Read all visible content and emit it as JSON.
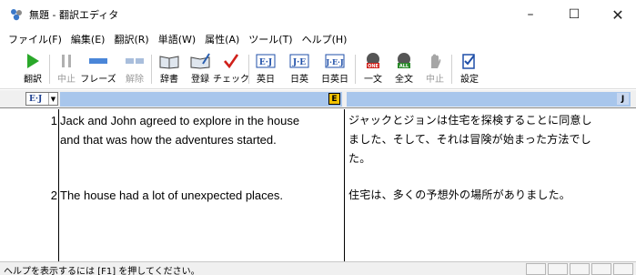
{
  "window": {
    "title": "無題 - 翻訳エディタ",
    "minimize_glyph": "–",
    "maximize_glyph": "☐",
    "close_glyph": "✕"
  },
  "menubar": {
    "items": [
      "ファイル(F)",
      "編集(E)",
      "翻訳(R)",
      "単語(W)",
      "属性(A)",
      "ツール(T)",
      "ヘルプ(H)"
    ]
  },
  "toolbar": {
    "buttons": [
      {
        "label": "翻訳",
        "icon": "play-icon",
        "enabled": true
      },
      {
        "label": "中止",
        "icon": "pause-icon",
        "enabled": false
      },
      {
        "label": "フレーズ",
        "icon": "phrase-icon",
        "enabled": true
      },
      {
        "label": "解除",
        "icon": "unphrase-icon",
        "enabled": false
      },
      {
        "label": "辞書",
        "icon": "book-icon",
        "enabled": true
      },
      {
        "label": "登録",
        "icon": "register-book-icon",
        "enabled": true
      },
      {
        "label": "チェック",
        "icon": "check-icon",
        "enabled": true
      },
      {
        "label": "英日",
        "icon": "en-ja-icon",
        "enabled": true
      },
      {
        "label": "日英",
        "icon": "ja-en-icon",
        "enabled": true
      },
      {
        "label": "日英日",
        "icon": "ja-en-ja-icon",
        "enabled": true
      },
      {
        "label": "一文",
        "icon": "one-sentence-icon",
        "enabled": true
      },
      {
        "label": "全文",
        "icon": "all-sentences-icon",
        "enabled": true
      },
      {
        "label": "中止",
        "icon": "stop-icon",
        "enabled": false
      },
      {
        "label": "設定",
        "icon": "settings-icon",
        "enabled": true
      }
    ]
  },
  "header": {
    "direction_value": "E·J",
    "direction_arrow": "▼",
    "source_lang_badge": "E",
    "target_lang_badge": "J"
  },
  "rows": [
    {
      "num": "1",
      "src_lines": [
        "Jack and John agreed to explore in the house",
        "and that was how the adventures started."
      ],
      "tgt_lines": [
        "ジャックとジョンは住宅を探検することに同意し",
        "ました、そして、それは冒険が始まった方法でし",
        "た。"
      ]
    },
    {
      "num": "2",
      "src_lines": [
        "The house had a lot of unexpected places."
      ],
      "tgt_lines": [
        "住宅は、多くの予想外の場所がありました。"
      ]
    }
  ],
  "status": {
    "text": "ヘルプを表示するには [F1] を押してください。"
  },
  "colors": {
    "header_bar": "#a8c6ec",
    "play_green": "#2aa82a",
    "check_red": "#d0201a",
    "icon_blue": "#1f4fa8"
  }
}
